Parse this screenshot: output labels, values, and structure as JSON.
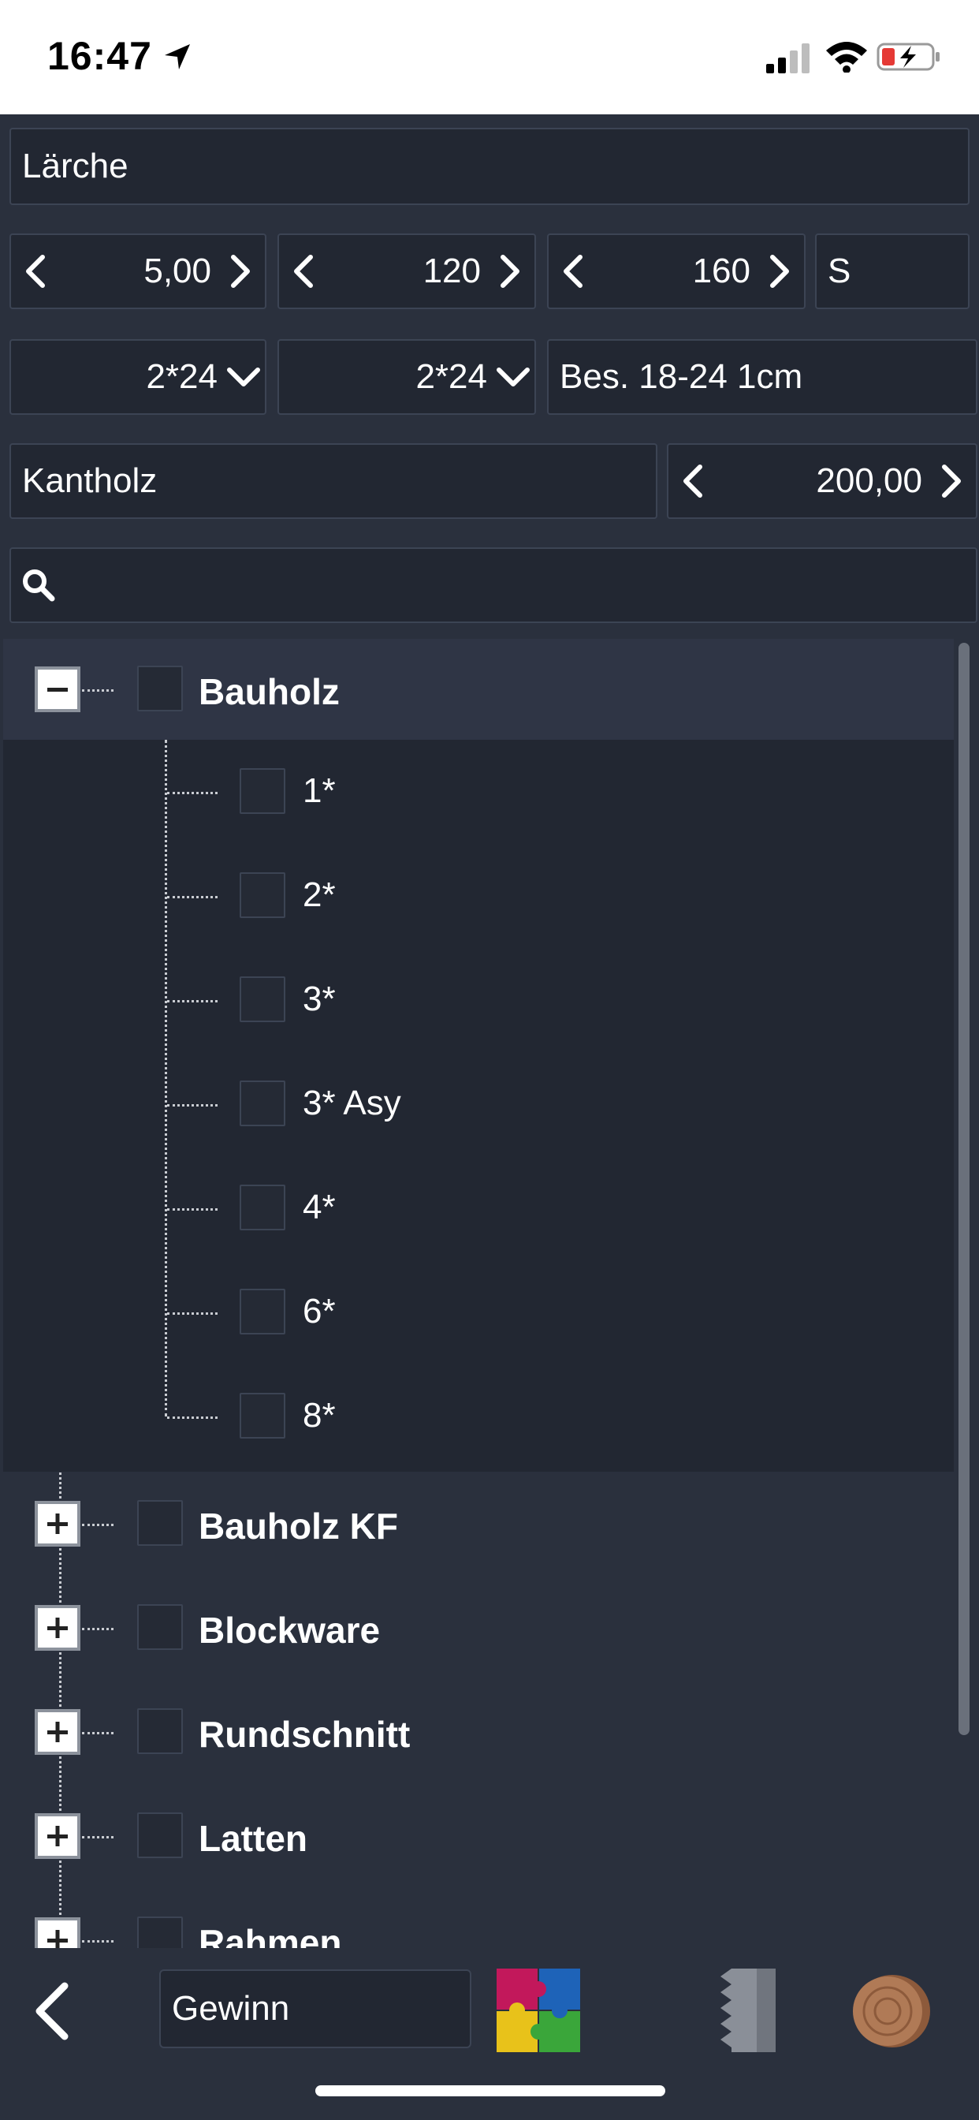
{
  "status_bar": {
    "time": "16:47"
  },
  "wood_type": "Lärche",
  "steppers": [
    {
      "value": "5,00"
    },
    {
      "value": "120"
    },
    {
      "value": "160"
    }
  ],
  "s_field": "S",
  "dropdowns": [
    {
      "value": "2*24"
    },
    {
      "value": "2*24"
    }
  ],
  "bes_field": "Bes. 18-24 1cm",
  "category_field": "Kantholz",
  "length_stepper": {
    "value": "200,00"
  },
  "search": {
    "placeholder": "",
    "icon": "search-icon"
  },
  "tree": {
    "groups": [
      {
        "label": "Bauholz",
        "expanded": true,
        "children": [
          "1*",
          "2*",
          "3*",
          "3* Asy",
          "4*",
          "6*",
          "8*"
        ]
      },
      {
        "label": "Bauholz KF",
        "expanded": false
      },
      {
        "label": "Blockware",
        "expanded": false
      },
      {
        "label": "Rundschnitt",
        "expanded": false
      },
      {
        "label": "Latten",
        "expanded": false
      },
      {
        "label": "Rahmen",
        "expanded": false
      }
    ]
  },
  "bottom_bar": {
    "gewinn": "Gewinn",
    "icons": [
      "back-icon",
      "puzzle-icon",
      "saw-blade-icon",
      "log-icon"
    ]
  },
  "colors": {
    "background": "#2a303d",
    "field": "#222732",
    "border": "#3c4454",
    "expanded_row": "#2f3545"
  }
}
